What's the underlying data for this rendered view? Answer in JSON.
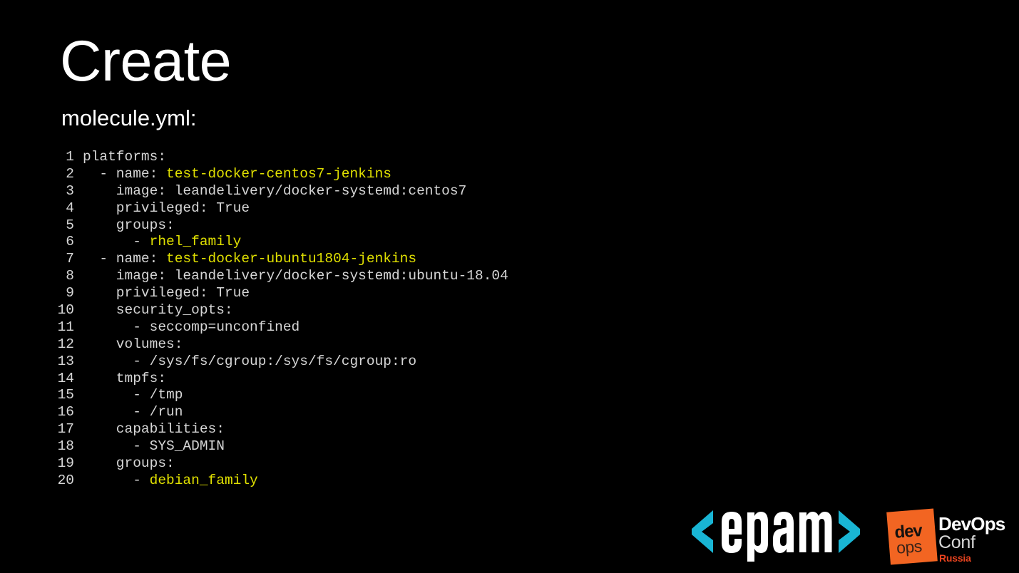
{
  "slide": {
    "title": "Create",
    "subtitle": "molecule.yml:",
    "background_color": "#000000"
  },
  "colors": {
    "background": "#000000",
    "title_text": "#ffffff",
    "code_text": "#d6d6d6",
    "code_value": "#e0e000",
    "epam_bracket_cyan": "#19b5d4",
    "epam_word_white": "#ffffff",
    "devops_orange": "#f26522",
    "devops_russia_orange": "#e8431f",
    "devops_conf_gray": "#d9d9d9"
  },
  "code": {
    "language": "yaml",
    "filename": "molecule.yml",
    "line_count": 20,
    "lines": [
      {
        "n": "1",
        "tokens": [
          {
            "t": "platforms:",
            "c": "plain"
          }
        ]
      },
      {
        "n": "2",
        "tokens": [
          {
            "t": "  - name: ",
            "c": "plain"
          },
          {
            "t": "test-docker-centos7-jenkins",
            "c": "value"
          }
        ]
      },
      {
        "n": "3",
        "tokens": [
          {
            "t": "    image: leandelivery/docker-systemd:centos7",
            "c": "plain"
          }
        ]
      },
      {
        "n": "4",
        "tokens": [
          {
            "t": "    privileged: True",
            "c": "plain"
          }
        ]
      },
      {
        "n": "5",
        "tokens": [
          {
            "t": "    groups:",
            "c": "plain"
          }
        ]
      },
      {
        "n": "6",
        "tokens": [
          {
            "t": "      - ",
            "c": "plain"
          },
          {
            "t": "rhel_family",
            "c": "value"
          }
        ]
      },
      {
        "n": "7",
        "tokens": [
          {
            "t": "  - name: ",
            "c": "plain"
          },
          {
            "t": "test-docker-ubuntu1804-jenkins",
            "c": "value"
          }
        ]
      },
      {
        "n": "8",
        "tokens": [
          {
            "t": "    image: leandelivery/docker-systemd:ubuntu-18.04",
            "c": "plain"
          }
        ]
      },
      {
        "n": "9",
        "tokens": [
          {
            "t": "    privileged: True",
            "c": "plain"
          }
        ]
      },
      {
        "n": "10",
        "tokens": [
          {
            "t": "    security_opts:",
            "c": "plain"
          }
        ]
      },
      {
        "n": "11",
        "tokens": [
          {
            "t": "      - seccomp=unconfined",
            "c": "plain"
          }
        ]
      },
      {
        "n": "12",
        "tokens": [
          {
            "t": "    volumes:",
            "c": "plain"
          }
        ]
      },
      {
        "n": "13",
        "tokens": [
          {
            "t": "      - /sys/fs/cgroup:/sys/fs/cgroup:ro",
            "c": "plain"
          }
        ]
      },
      {
        "n": "14",
        "tokens": [
          {
            "t": "    tmpfs:",
            "c": "plain"
          }
        ]
      },
      {
        "n": "15",
        "tokens": [
          {
            "t": "      - /tmp",
            "c": "plain"
          }
        ]
      },
      {
        "n": "16",
        "tokens": [
          {
            "t": "      - /run",
            "c": "plain"
          }
        ]
      },
      {
        "n": "17",
        "tokens": [
          {
            "t": "    capabilities:",
            "c": "plain"
          }
        ]
      },
      {
        "n": "18",
        "tokens": [
          {
            "t": "      - SYS_ADMIN",
            "c": "plain"
          }
        ]
      },
      {
        "n": "19",
        "tokens": [
          {
            "t": "    groups:",
            "c": "plain"
          }
        ]
      },
      {
        "n": "20",
        "tokens": [
          {
            "t": "      - ",
            "c": "plain"
          },
          {
            "t": "debian_family",
            "c": "value"
          }
        ]
      }
    ]
  },
  "footer": {
    "epam": {
      "word": "epam",
      "left_bracket": "<",
      "right_bracket": ">"
    },
    "devops_conf": {
      "badge_top": "dev",
      "badge_bottom": "ops",
      "title": "DevOps",
      "subtitle": "Conf",
      "region": "Russia"
    }
  }
}
